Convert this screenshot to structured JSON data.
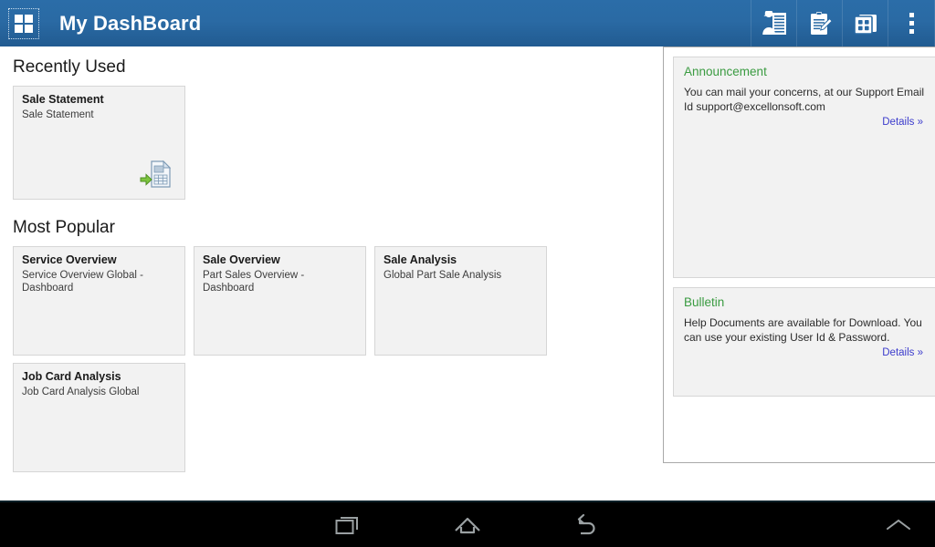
{
  "header": {
    "title": "My DashBoard",
    "grid_icon": "apps-grid-icon",
    "actions": [
      {
        "name": "contact-card-icon",
        "label": "Contacts"
      },
      {
        "name": "clipboard-edit-icon",
        "label": "Notes"
      },
      {
        "name": "apps-stack-icon",
        "label": "Apps"
      },
      {
        "name": "overflow-menu-icon",
        "label": "More options"
      }
    ],
    "colors": {
      "gradient_top": "#2b6da8",
      "gradient_bottom": "#215b91",
      "text": "#ffffff"
    }
  },
  "main": {
    "recently_used": {
      "heading": "Recently Used",
      "items": [
        {
          "title": "Sale Statement",
          "subtitle": "Sale Statement",
          "icon": "document-import-icon"
        }
      ]
    },
    "most_popular": {
      "heading": "Most Popular",
      "items": [
        {
          "title": "Service Overview",
          "subtitle": "Service Overview Global - Dashboard"
        },
        {
          "title": "Sale Overview",
          "subtitle": "Part Sales Overview - Dashboard"
        },
        {
          "title": "Sale Analysis",
          "subtitle": "Global Part Sale Analysis"
        },
        {
          "title": "Job Card Analysis",
          "subtitle": "Job Card Analysis Global"
        }
      ]
    }
  },
  "sidebar": {
    "panels": [
      {
        "title": "Announcement",
        "body": "You can mail your concerns, at our Support Email Id support@excellonsoft.com",
        "link": "Details »"
      },
      {
        "title": "Bulletin",
        "body": "Help Documents are available for Download. You can use your existing User Id & Password.",
        "link": "Details »"
      }
    ],
    "colors": {
      "title": "#3a9b41",
      "link": "#3b3bcc",
      "panel_bg": "#f2f2f2"
    }
  },
  "navbar": {
    "buttons": [
      {
        "name": "recents-icon",
        "label": "Recent apps"
      },
      {
        "name": "home-icon",
        "label": "Home"
      },
      {
        "name": "back-icon",
        "label": "Back"
      },
      {
        "name": "expand-chevron-icon",
        "label": "Expand"
      }
    ],
    "colors": {
      "background": "#000000",
      "icon": "#9aa0a2"
    }
  }
}
